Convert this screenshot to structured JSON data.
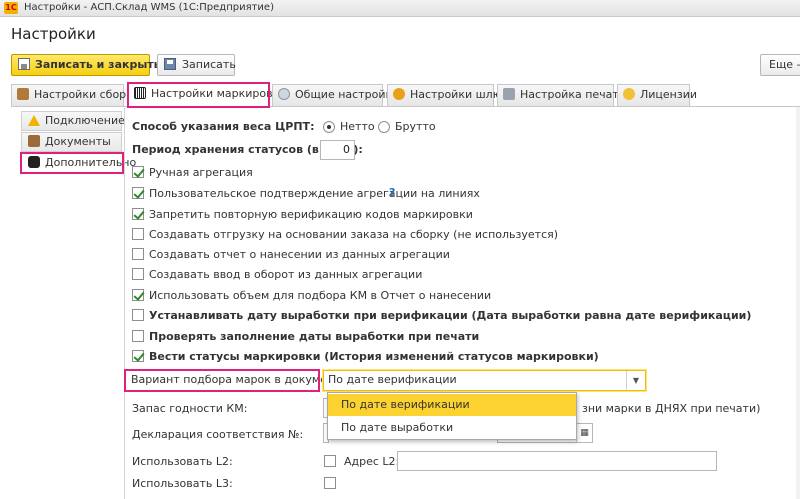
{
  "window": {
    "title": "Настройки - АСП.Склад WMS  (1С:Предприятие)",
    "logo_text": "1С"
  },
  "page": {
    "title": "Настройки"
  },
  "toolbar": {
    "save_close_label": "Записать и закрыть",
    "save_label": "Записать",
    "more_label": "Еще -"
  },
  "tabs": [
    {
      "label": "Настройки сборки",
      "icon": "assembly-icon",
      "active": false
    },
    {
      "label": "Настройки маркировки",
      "icon": "barcode-icon",
      "active": true
    },
    {
      "label": "Общие настройки",
      "icon": "gear-icon",
      "active": false
    },
    {
      "label": "Настройки шлюз",
      "icon": "gateway-icon",
      "active": false
    },
    {
      "label": "Настройка печати",
      "icon": "printer-icon",
      "active": false
    },
    {
      "label": "Лицензии",
      "icon": "license-icon",
      "active": false
    }
  ],
  "sidebar": {
    "items": [
      {
        "label": "Подключение",
        "icon": "warning-icon",
        "active": false
      },
      {
        "label": "Документы",
        "icon": "briefcase-icon",
        "active": false
      },
      {
        "label": "Дополнительно",
        "icon": "chat-icon",
        "active": true
      }
    ]
  },
  "form": {
    "weight_method_label": "Способ указания веса ЦРПТ:",
    "weight_options": [
      {
        "label": "Нетто",
        "selected": true
      },
      {
        "label": "Брутто",
        "selected": false
      }
    ],
    "status_period_label": "Период хранения статусов (в днях):",
    "status_period_value": "0",
    "checkboxes": [
      {
        "label": "Ручная агрегация",
        "checked": true,
        "bold": false,
        "help": ""
      },
      {
        "label": "Пользовательское подтверждение агрегации на линиях",
        "checked": true,
        "bold": false,
        "help": "?"
      },
      {
        "label": "Запретить повторную верификацию кодов маркировки",
        "checked": true,
        "bold": false,
        "help": ""
      },
      {
        "label": "Создавать отгрузку на основании заказа на сборку (не используется)",
        "checked": false,
        "bold": false,
        "help": ""
      },
      {
        "label": "Создавать отчет о нанесении из данных агрегации",
        "checked": false,
        "bold": false,
        "help": ""
      },
      {
        "label": "Создавать ввод в оборот из данных агрегации",
        "checked": false,
        "bold": false,
        "help": ""
      },
      {
        "label": "Использовать объем для подбора КМ в Отчет о нанесении",
        "checked": true,
        "bold": false,
        "help": ""
      },
      {
        "label": "Устанавливать дату выработки при верификации (Дата выработки равна дате верификации)",
        "checked": false,
        "bold": true,
        "help": ""
      },
      {
        "label": "Проверять заполнение даты выработки при печати",
        "checked": false,
        "bold": true,
        "help": ""
      },
      {
        "label": "Вести статусы маркировки (История изменений статусов маркировки)",
        "checked": true,
        "bold": true,
        "help": ""
      }
    ],
    "variant_label": "Вариант подбора марок в документы:",
    "variant_value": "По дате верификации",
    "variant_options": [
      {
        "label": "По дате верификации",
        "selected": true
      },
      {
        "label": "По дате выработки",
        "selected": false
      }
    ],
    "shelf_life_label": "Запас годности КМ:",
    "shelf_life_tail": "зни марки в ДНЯХ при печати)",
    "declaration_label": "Декларация соответствия №:",
    "l2_label": "Использовать L2:",
    "l2_checked": false,
    "l2_address_label": "Адрес L2:",
    "l2_address_value": "",
    "l3_label": "Использовать L3:",
    "l3_checked": false
  },
  "colors": {
    "accent_yellow": "#f6cf11",
    "highlight_pink": "#e0207a",
    "selected_option": "#fbd22f",
    "check_green": "#2b8a2b"
  }
}
